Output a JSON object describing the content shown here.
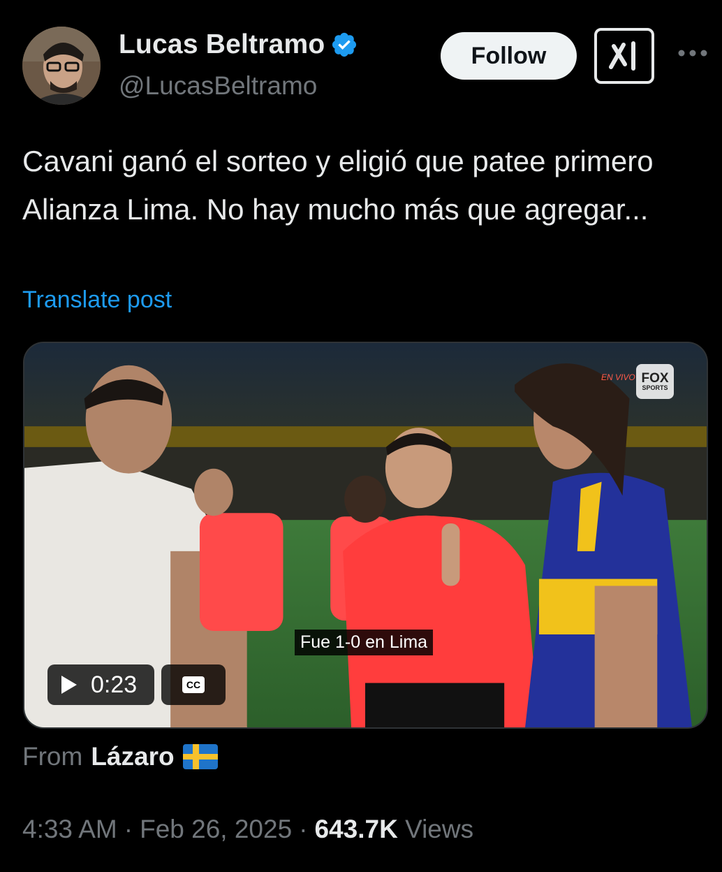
{
  "author": {
    "display_name": "Lucas Beltramo",
    "handle": "@LucasBeltramo",
    "verified_icon": "verified-badge-icon",
    "avatar_icon": "user-avatar"
  },
  "actions": {
    "follow_label": "Follow",
    "grok_icon": "grok-icon",
    "more_icon": "more-dots-icon"
  },
  "post": {
    "text": "Cavani ganó el sorteo y eligió que patee primero Alianza Lima. No hay mucho más que agregar...",
    "translate_label": "Translate post"
  },
  "video": {
    "caption": "Fue 1-0 en Lima",
    "time": "0:23",
    "cc_label": "CC",
    "broadcaster": {
      "line1": "FOX",
      "line2": "SPORTS"
    },
    "live_label": "EN VIVO",
    "play_icon": "play-icon"
  },
  "attribution": {
    "from_label": "From",
    "from_name": "Lázaro",
    "flag_icon": "sweden-flag-icon"
  },
  "meta": {
    "time": "4:33 AM",
    "separator": "·",
    "date": "Feb 26, 2025",
    "views_count": "643.7K",
    "views_label": "Views"
  },
  "colors": {
    "background": "#000000",
    "text_primary": "#e7e9ea",
    "text_secondary": "#71767b",
    "link": "#1d9bf0",
    "verified": "#1d9bf0"
  }
}
